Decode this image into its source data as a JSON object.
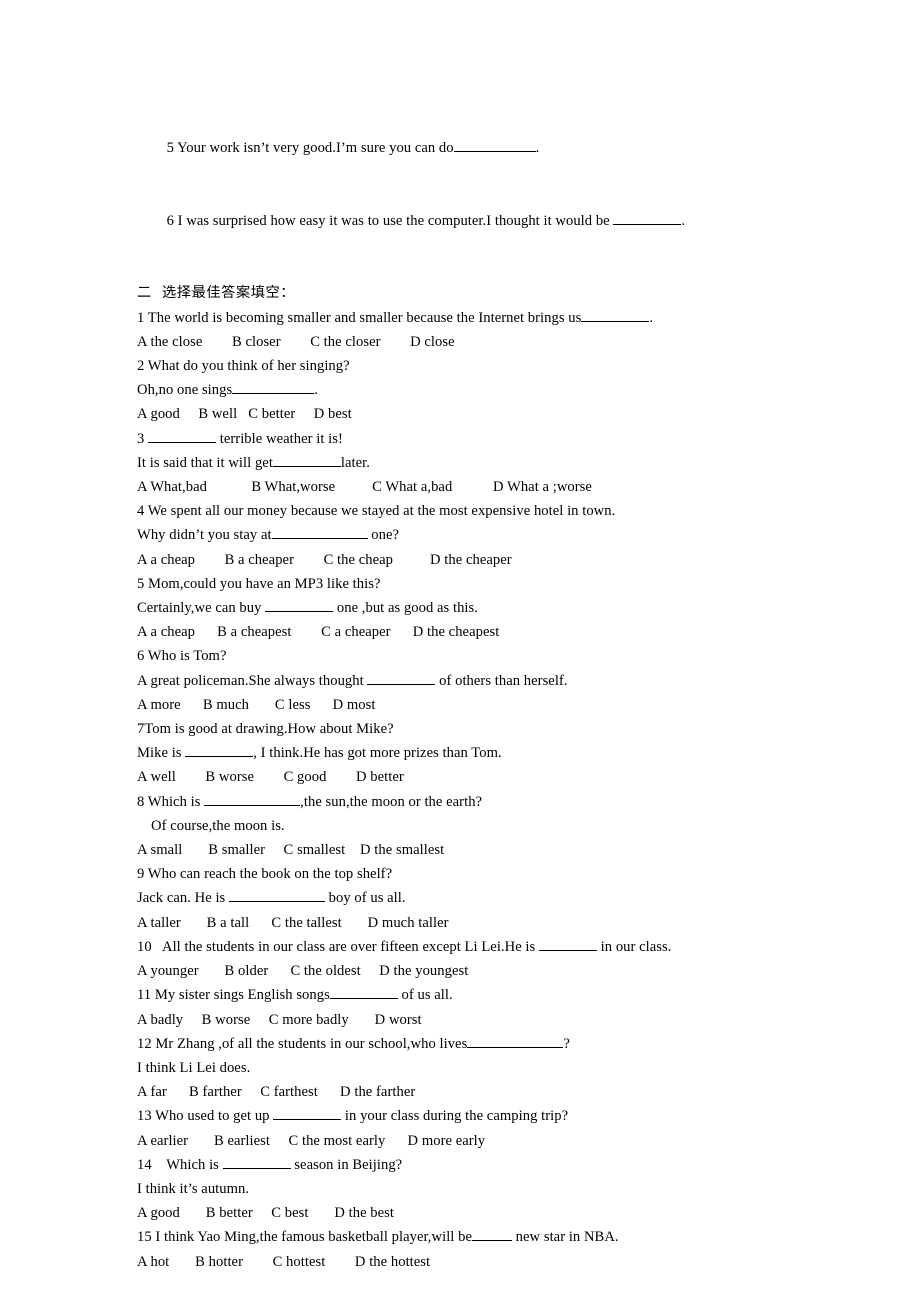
{
  "document": {
    "page_background": "#ffffff",
    "text_color": "#000000",
    "carryover_items": [
      {
        "id": "carry-5",
        "pre": "5 Your work isn’t very good.I’m sure you can do",
        "blank": "b-lg",
        "post": "."
      },
      {
        "id": "carry-6",
        "pre": "6 I was surprised how easy it was to use the computer.I thought it would be ",
        "blank": "b-md",
        "post": "."
      }
    ],
    "section_heading": "二  选择最佳答案填空：",
    "questions": [
      {
        "number": "1",
        "stem_pre": "1 The world is becoming smaller and smaller because the Internet brings us",
        "stem_blank": "b-md",
        "stem_post": ".",
        "extra_lines": [],
        "options": "A the close        B closer        C the closer        D close"
      },
      {
        "number": "2",
        "stem_pre": "2 What do you think of her singing?",
        "stem_blank": "",
        "stem_post": "",
        "extra_lines": [
          {
            "pre": "Oh,no one sings",
            "blank": "b-lg",
            "post": "."
          }
        ],
        "options": "A good     B well   C better     D best"
      },
      {
        "number": "3",
        "stem_pre": "3 ",
        "stem_blank": "b-md",
        "stem_post": " terrible weather it is!",
        "extra_lines": [
          {
            "pre": "It is said that it will get",
            "blank": "b-md",
            "post": "later."
          }
        ],
        "options": "A What,bad            B What,worse          C What a,bad           D What a ;worse"
      },
      {
        "number": "4",
        "stem_pre": "4 We spent all our money because we stayed at the most expensive hotel in town.",
        "stem_blank": "",
        "stem_post": "",
        "extra_lines": [
          {
            "pre": "Why didn’t you stay at",
            "blank": "b-xl",
            "post": " one?"
          }
        ],
        "options": "A a cheap        B a cheaper        C the cheap          D the cheaper"
      },
      {
        "number": "5",
        "stem_pre": "5 Mom,could you have an MP3 like this?",
        "stem_blank": "",
        "stem_post": "",
        "extra_lines": [
          {
            "pre": "Certainly,we can buy ",
            "blank": "b-md",
            "post": " one ,but as good as this."
          }
        ],
        "options": "A a cheap      B a cheapest        C a cheaper      D the cheapest"
      },
      {
        "number": "6",
        "stem_pre": "6 Who is Tom?",
        "stem_blank": "",
        "stem_post": "",
        "extra_lines": [
          {
            "pre": "A great policeman.She always thought ",
            "blank": "b-md",
            "post": " of others than herself."
          }
        ],
        "options": "A more      B much       C less      D most"
      },
      {
        "number": "7",
        "stem_pre": "7Tom is good at drawing.How about Mike?",
        "stem_blank": "",
        "stem_post": "",
        "extra_lines": [
          {
            "pre": "Mike is ",
            "blank": "b-md",
            "post": ", I think.He has got more prizes than Tom."
          }
        ],
        "options": "A well        B worse        C good        D better"
      },
      {
        "number": "8",
        "stem_pre": "8 Which is ",
        "stem_blank": "b-xl",
        "stem_post": ",the sun,the moon or the earth?",
        "extra_lines": [
          {
            "pre": "Of course,the moon is.",
            "blank": "",
            "post": "",
            "indent": true
          }
        ],
        "options": "A small       B smaller     C smallest    D the smallest"
      },
      {
        "number": "9",
        "stem_pre": "9 Who can reach the book on the top shelf?",
        "stem_blank": "",
        "stem_post": "",
        "extra_lines": [
          {
            "pre": "Jack can. He is ",
            "blank": "b-xl",
            "post": " boy of us all."
          }
        ],
        "options": "A taller       B a tall      C the tallest       D much taller"
      },
      {
        "number": "10",
        "stem_pre": "10   All the students in our class are over fifteen except Li Lei.He is ",
        "stem_blank": "b-sm",
        "stem_post": " in our class.",
        "extra_lines": [],
        "options": "A younger       B older      C the oldest     D the youngest"
      },
      {
        "number": "11",
        "stem_pre": "11 My sister sings English songs",
        "stem_blank": "b-md",
        "stem_post": " of us all.",
        "extra_lines": [],
        "options": "A badly     B worse     C more badly       D worst"
      },
      {
        "number": "12",
        "stem_pre": "12 Mr Zhang ,of all the students in our school,who lives",
        "stem_blank": "b-xl",
        "stem_post": "?",
        "extra_lines": [
          {
            "pre": "I think Li Lei does.",
            "blank": "",
            "post": ""
          }
        ],
        "options": "A far      B farther     C farthest      D the farther"
      },
      {
        "number": "13",
        "stem_pre": "13 Who used to get up ",
        "stem_blank": "b-md",
        "stem_post": " in your class during the camping trip?",
        "extra_lines": [],
        "options": "A earlier       B earliest     C the most early      D more early"
      },
      {
        "number": "14",
        "stem_pre": "14    Which is ",
        "stem_blank": "b-md",
        "stem_post": " season in Beijing?",
        "extra_lines": [
          {
            "pre": "I think it’s autumn.",
            "blank": "",
            "post": ""
          }
        ],
        "options": "A good       B better     C best       D the best"
      },
      {
        "number": "15",
        "stem_pre": "15 I think Yao Ming,the famous basketball player,will be",
        "stem_blank": "b-xs",
        "stem_post": " new star in NBA.",
        "extra_lines": [],
        "options": "A hot       B hotter        C hottest        D the hottest"
      }
    ]
  }
}
